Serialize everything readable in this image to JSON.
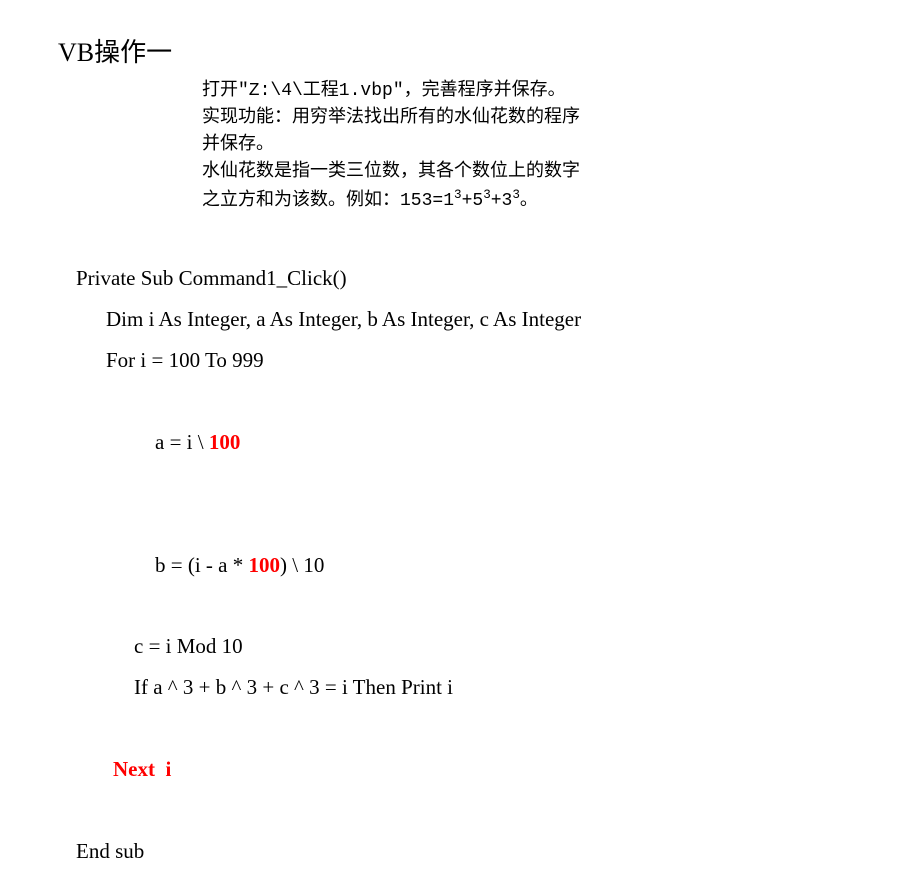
{
  "title": "VB操作一",
  "instructions": {
    "line1": "打开\"Z:\\4\\工程1.vbp\"，完善程序并保存。",
    "line2": "实现功能：用穷举法找出所有的水仙花数的程序",
    "line3": "并保存。",
    "line4": "水仙花数是指一类三位数，其各个数位上的数字",
    "line5_prefix": "之立方和为该数。例如：153=1",
    "line5_sup1": "3",
    "line5_mid1": "+5",
    "line5_sup2": "3",
    "line5_mid2": "+3",
    "line5_sup3": "3",
    "line5_suffix": "。"
  },
  "code": {
    "line1": "Private Sub Command1_Click()",
    "line2": "Dim i As Integer, a As Integer, b As Integer, c As Integer",
    "line3": "For i = 100 To 999",
    "line4_a": "a = i \\ ",
    "line4_b": "100",
    "line5_a": "b = (i - a * ",
    "line5_b": "100",
    "line5_c": ") \\ 10",
    "line6": "c = i Mod 10",
    "line7": "If a ^ 3 + b ^ 3 + c ^ 3 = i Then Print i",
    "line8": "Next  i",
    "line9": "End sub"
  }
}
